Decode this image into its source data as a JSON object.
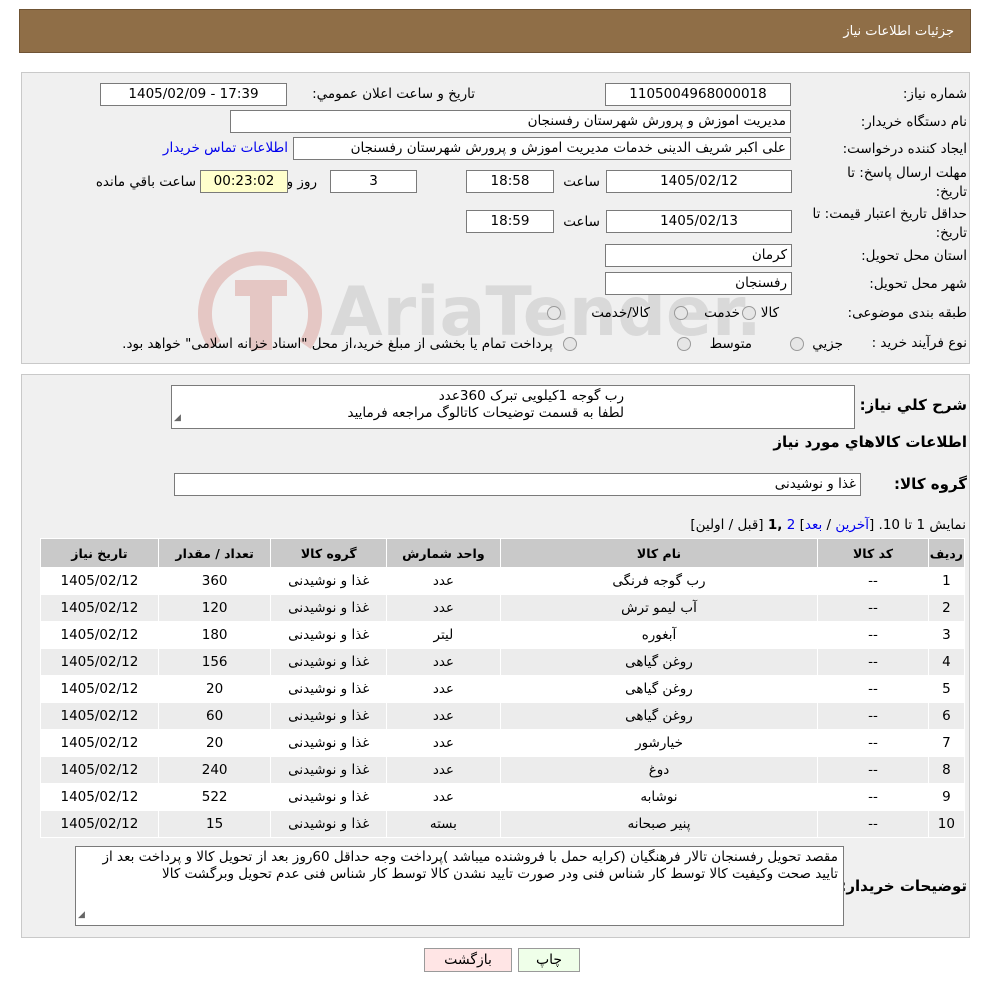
{
  "header": {
    "title": "جزئیات اطلاعات نیاز"
  },
  "form": {
    "need_number_label": "شماره نیاز:",
    "need_number": "1105004968000018",
    "announce_label": "تاریخ و ساعت اعلان عمومي:",
    "announce_value": "1405/02/09 - 17:39",
    "buyer_org_label": "نام دستگاه خريدار:",
    "buyer_org": "مديريت اموزش و پرورش شهرستان رفسنجان",
    "requester_label": "ايجاد کننده درخواست:",
    "requester": "علی اکبر شریف الدینی خدمات مديريت اموزش و پرورش شهرستان رفسنجان",
    "contact_link": "اطلاعات تماس خريدار",
    "deadline_label_1": "مهلت ارسال پاسخ: تا",
    "deadline_label_2": "تاریخ:",
    "deadline_date": "1405/02/12",
    "time_label": "ساعت",
    "deadline_time": "18:58",
    "days_value": "3",
    "days_label": "روز و",
    "remaining_time": "00:23:02",
    "remaining_label": "ساعت باقي مانده",
    "validity_label_1": "حداقل تاريخ اعتبار قيمت: تا",
    "validity_label_2": "تاریخ:",
    "validity_date": "1405/02/13",
    "validity_time": "18:59",
    "province_label": "استان محل تحويل:",
    "province": "کرمان",
    "city_label": "شهر محل تحويل:",
    "city": "رفسنجان",
    "category_label": "طبقه بندی موضوعی:",
    "category_options": [
      "کالا",
      "خدمت",
      "کالا/خدمت"
    ],
    "process_label": "نوع فرآيند خريد :",
    "process_options": [
      "جزيي",
      "متوسط"
    ],
    "process_note": "پرداخت تمام يا بخشی از مبلغ خريد،از محل \"اسناد خزانه اسلامی\" خواهد بود."
  },
  "summary": {
    "label": "شرح کلي نياز:",
    "line1": "رب گوجه  1کیلویی تبرک 360عدد",
    "line2": "لطفا به قسمت توضیحات کاتالوگ مراجعه فرمایید"
  },
  "goods_info_title": "اطلاعات کالاهاي مورد نياز",
  "goods_group": {
    "label": "گروه کالا:",
    "value": "غذا و نوشیدنی"
  },
  "pagination": {
    "prefix": "نمايش 1 تا 10. [",
    "last": "آخرين",
    "sep1": "/",
    "next": "بعد",
    "close1": "]",
    "page2": "2",
    "page1": ",1",
    "tail": "[قبل / اولين]"
  },
  "table": {
    "headers": [
      "رديف",
      "کد کالا",
      "نام کالا",
      "واحد شمارش",
      "گروه کالا",
      "تعداد / مقدار",
      "تاريخ نياز"
    ],
    "rows": [
      [
        "1",
        "--",
        "رب گوجه فرنگی",
        "عدد",
        "غذا و نوشیدنی",
        "360",
        "1405/02/12"
      ],
      [
        "2",
        "--",
        "آب لیمو ترش",
        "عدد",
        "غذا و نوشیدنی",
        "120",
        "1405/02/12"
      ],
      [
        "3",
        "--",
        "آبغوره",
        "لیتر",
        "غذا و نوشیدنی",
        "180",
        "1405/02/12"
      ],
      [
        "4",
        "--",
        "روغن گیاهی",
        "عدد",
        "غذا و نوشیدنی",
        "156",
        "1405/02/12"
      ],
      [
        "5",
        "--",
        "روغن گیاهی",
        "عدد",
        "غذا و نوشیدنی",
        "20",
        "1405/02/12"
      ],
      [
        "6",
        "--",
        "روغن گیاهی",
        "عدد",
        "غذا و نوشیدنی",
        "60",
        "1405/02/12"
      ],
      [
        "7",
        "--",
        "خیارشور",
        "عدد",
        "غذا و نوشیدنی",
        "20",
        "1405/02/12"
      ],
      [
        "8",
        "--",
        "دوغ",
        "عدد",
        "غذا و نوشیدنی",
        "240",
        "1405/02/12"
      ],
      [
        "9",
        "--",
        "نوشابه",
        "عدد",
        "غذا و نوشیدنی",
        "522",
        "1405/02/12"
      ],
      [
        "10",
        "--",
        "پنیر صبحانه",
        "بسته",
        "غذا و نوشیدنی",
        "15",
        "1405/02/12"
      ]
    ]
  },
  "buyer_notes": {
    "label": "توضيحات خريدار:",
    "text": "مقصد تحویل رفسنجان تالار فرهنگیان (کرایه حمل با فروشنده میباشد )پرداخت وجه حداقل 60روز بعد از تحویل کالا و پرداخت بعد از تایید صحت وکیفیت کالا توسط کار شناس فنی ودر صورت تایید نشدن کالا توسط کار شناس فنی عدم تحویل وبرگشت کالا"
  },
  "buttons": {
    "print": "چاپ",
    "back": "بازگشت"
  },
  "watermark": {
    "text": "AriaTender.neT"
  },
  "colors": {
    "header": "#8f6e47",
    "panel": "#f0f0f0",
    "table_header": "#c9c9c9",
    "link": "#0000ee"
  }
}
